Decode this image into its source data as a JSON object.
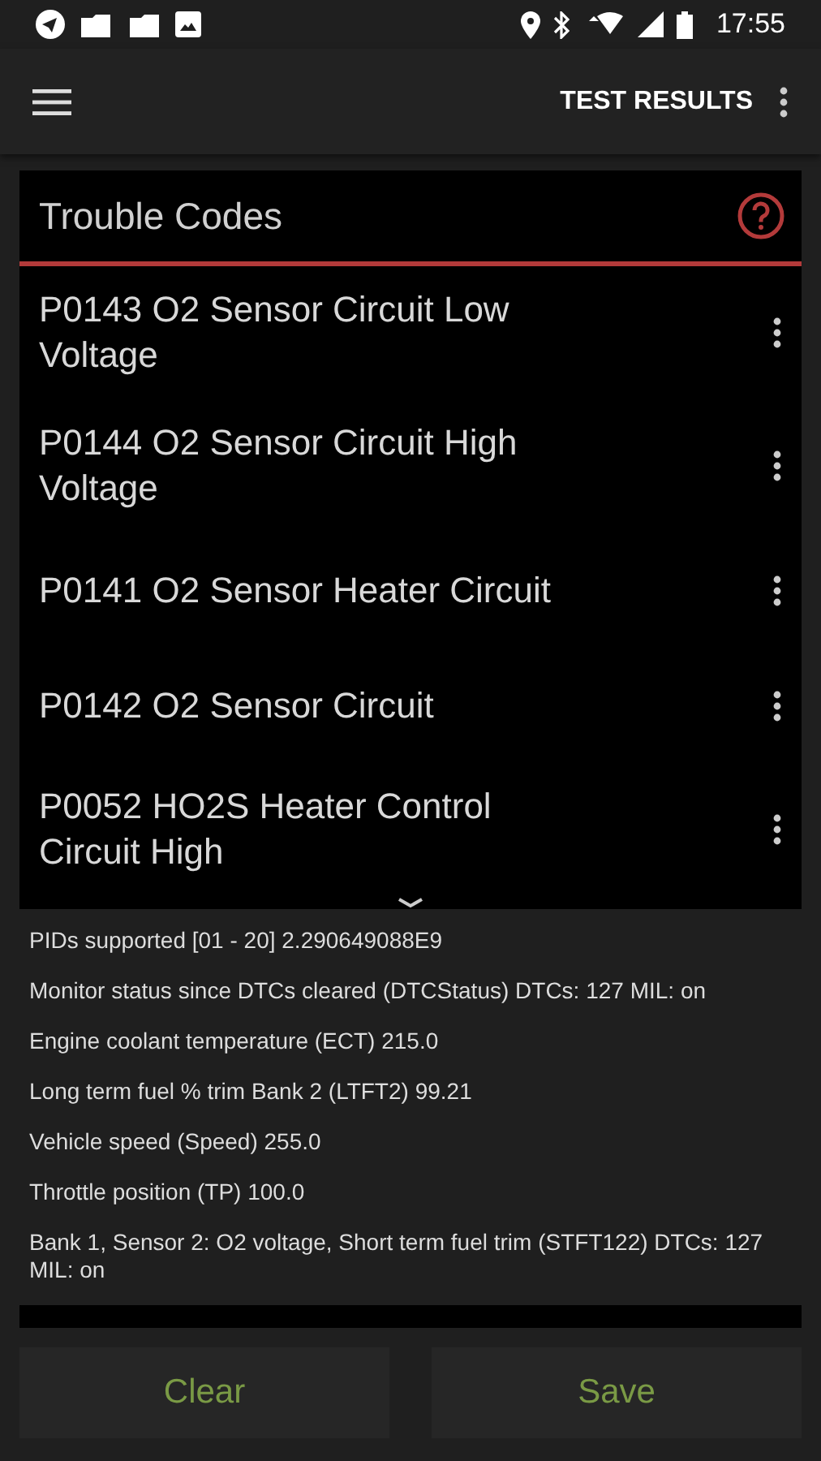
{
  "status_bar": {
    "time": "17:55"
  },
  "app_bar": {
    "title": "TEST RESULTS"
  },
  "trouble_codes": {
    "title": "Trouble Codes",
    "items": [
      {
        "text": "P0143 O2 Sensor Circuit Low Voltage"
      },
      {
        "text": "P0144 O2 Sensor Circuit High Voltage"
      },
      {
        "text": "P0141 O2 Sensor Heater Circuit"
      },
      {
        "text": "P0142 O2 Sensor Circuit"
      },
      {
        "text": "P0052 HO2S Heater Control Circuit High"
      }
    ]
  },
  "pids": [
    "PIDs supported [01 - 20] 2.290649088E9",
    "Monitor status since DTCs cleared (DTCStatus) DTCs: 127 MIL: on",
    "Engine coolant temperature (ECT) 215.0",
    "Long term fuel % trim Bank 2 (LTFT2) 99.21",
    "Vehicle speed (Speed) 255.0",
    "Throttle position (TP) 100.0",
    "Bank 1, Sensor 2: O2 voltage, Short term fuel trim (STFT122) DTCs: 127 MIL: on"
  ],
  "buttons": [
    "Clear",
    "Save"
  ]
}
